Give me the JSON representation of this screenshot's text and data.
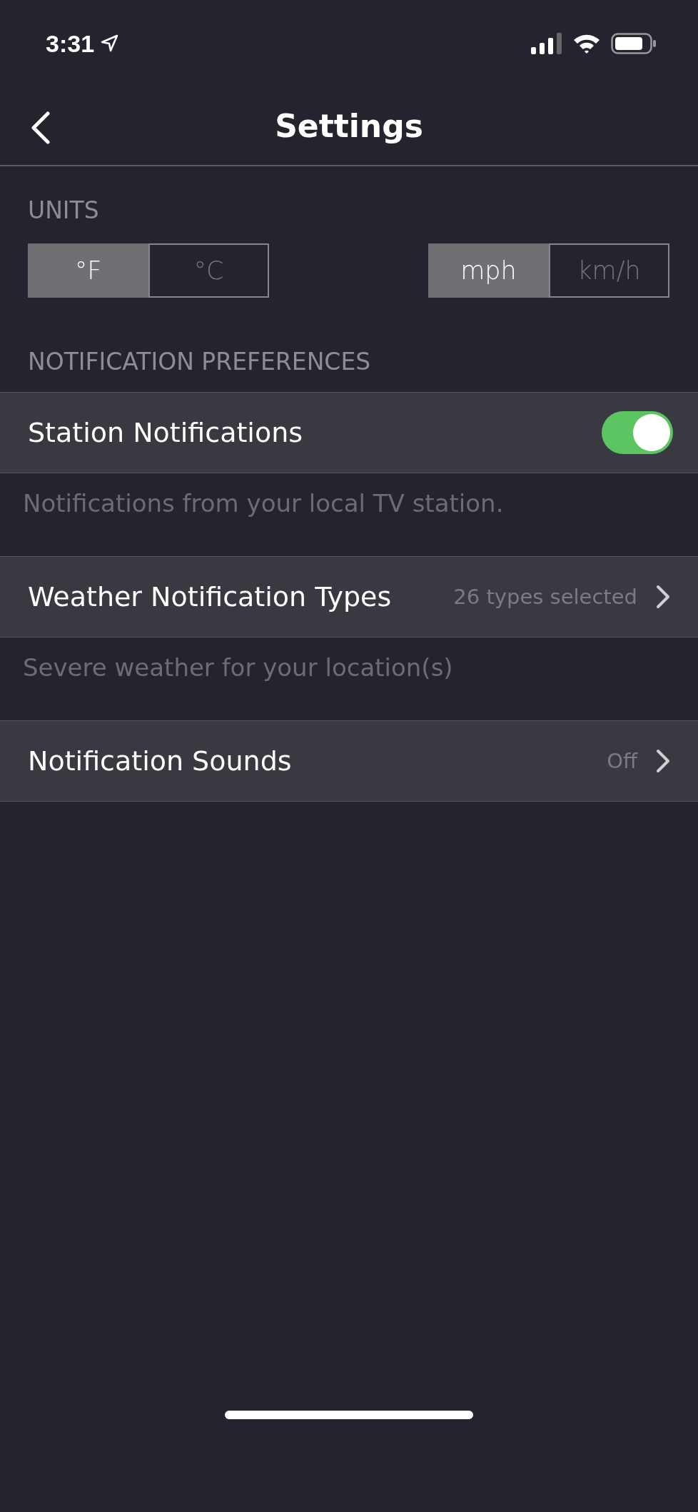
{
  "status_bar": {
    "time": "3:31"
  },
  "nav": {
    "title": "Settings"
  },
  "units": {
    "label": "UNITS",
    "groups": [
      {
        "options": [
          {
            "label": "°F",
            "selected": true
          },
          {
            "label": "°C",
            "selected": false
          }
        ]
      },
      {
        "options": [
          {
            "label": "mph",
            "selected": true
          },
          {
            "label": "km/h",
            "selected": false
          }
        ]
      }
    ]
  },
  "notification_preferences": {
    "label": "NOTIFICATION PREFERENCES",
    "rows": [
      {
        "kind": "toggle",
        "label": "Station Notifications",
        "on": true,
        "description": "Notifications from your local TV station."
      },
      {
        "kind": "link",
        "label": "Weather Notification Types",
        "value": "26 types selected",
        "description": "Severe weather for your location(s)"
      },
      {
        "kind": "link",
        "label": "Notification Sounds",
        "value": "Off"
      }
    ]
  }
}
